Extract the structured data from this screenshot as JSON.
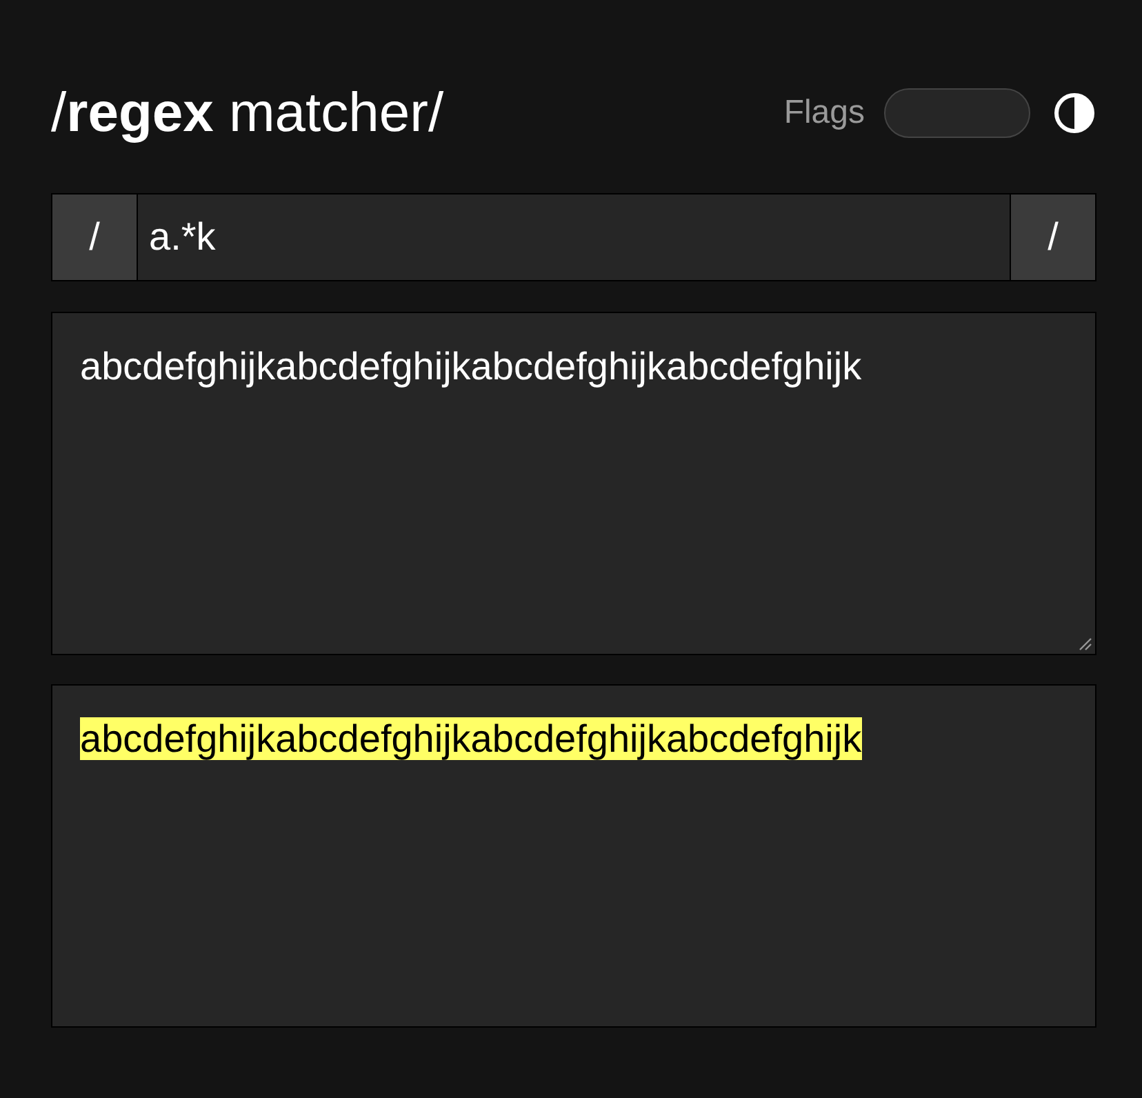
{
  "header": {
    "title": "/**regex** matcher/",
    "flags_label": "Flags",
    "flags_toggle": {
      "on": false
    }
  },
  "pattern": {
    "open_delimiter": "/",
    "value": "a.*k",
    "close_delimiter": "/"
  },
  "test_text": {
    "value": "abcdefghijkabcdefghijkabcdefghijkabcdefghijk"
  },
  "result": {
    "segments": [
      {
        "text": "abcdefghijkabcdefghijkabcdefghijkabcdefghijk",
        "matched": true
      }
    ]
  }
}
